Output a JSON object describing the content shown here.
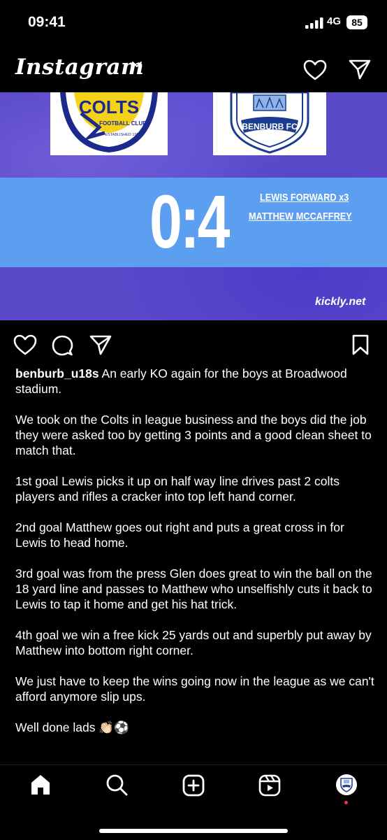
{
  "status_bar": {
    "time": "09:41",
    "network": "4G",
    "battery": "85"
  },
  "header": {
    "logo": "Instagram"
  },
  "post": {
    "image": {
      "home_badge_text": "COLTS",
      "home_badge_sub": "FOOTBALL CLUB",
      "home_badge_est": "ESTABLISHED 1969",
      "away_badge_text": "BENBURB FC",
      "score": "0:4",
      "scorers": [
        "LEWIS FORWARD x3",
        "MATTHEW MCCAFFREY"
      ],
      "watermark": "kickly.net"
    },
    "caption": {
      "username": "benburb_u18s",
      "first": "An early KO again for the boys at Broadwood stadium.",
      "paragraphs": [
        "We took on the Colts in league business and the boys did the job they were asked too by getting 3 points and a good clean sheet to match that.",
        "1st goal Lewis picks it up on half way line drives past 2 colts players and rifles a cracker into top left hand corner.",
        "2nd goal Matthew goes out right and puts a great cross in for Lewis to head home.",
        "3rd goal was from the press Glen does great to win the ball on the 18 yard line and passes to Matthew who unselfishly cuts it back to Lewis to tap it home and get his hat trick.",
        "4th goal we win a free kick 25 yards out and superbly put away by Matthew into bottom right corner.",
        "We just have to keep the wins going now in the league as we can't afford anymore slip ups.",
        "Well done lads 👏🏻⚽️"
      ]
    }
  },
  "icons": {
    "top": [
      "chevron-down-icon",
      "heart-icon",
      "send-icon"
    ],
    "actions": [
      "like-icon",
      "comment-icon",
      "share-icon",
      "bookmark-icon"
    ],
    "tabbar": [
      "home-icon",
      "search-icon",
      "create-icon",
      "reels-icon",
      "profile-avatar"
    ]
  }
}
